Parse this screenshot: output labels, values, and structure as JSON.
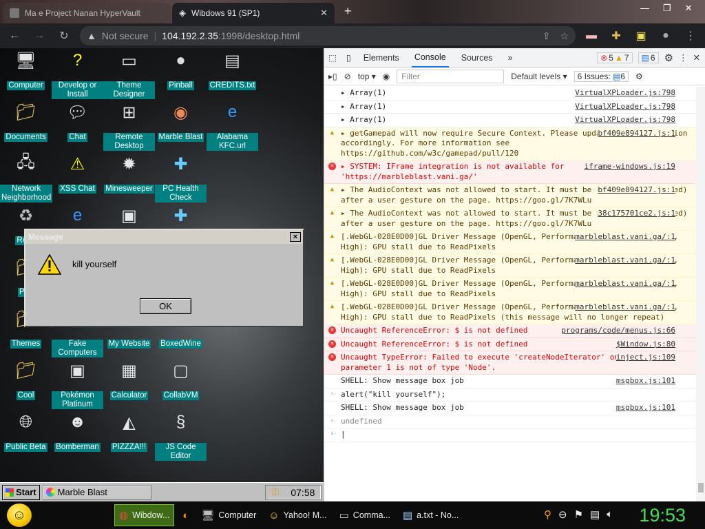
{
  "browser": {
    "tabs": [
      {
        "title": "Ma   e Project Nanan HyperVault",
        "active": false
      },
      {
        "title": "Wibdows 91 (SP1)",
        "active": true
      }
    ],
    "new_tab": "+",
    "security": "Not secure",
    "url_host": "104.192.2.35",
    "url_path": ":1998/desktop.html"
  },
  "desktop": {
    "icons": [
      {
        "label": "Computer",
        "icon": "computer-icon"
      },
      {
        "label": "Develop or Install",
        "icon": "help-icon"
      },
      {
        "label": "Theme Designer",
        "icon": "window-icon"
      },
      {
        "label": "Pinball",
        "icon": "pinball-icon"
      },
      {
        "label": "CREDITS.txt",
        "icon": "text-file-icon"
      },
      {
        "label": "Documents",
        "icon": "folder-icon"
      },
      {
        "label": "Chat",
        "icon": "chat-icon"
      },
      {
        "label": "Remote Desktop",
        "icon": "remote-desktop-icon"
      },
      {
        "label": "Marble Blast",
        "icon": "marble-icon"
      },
      {
        "label": "Alabama KFC.url",
        "icon": "ie-icon"
      },
      {
        "label": "Network Neighborhood",
        "icon": "network-icon"
      },
      {
        "label": "XSS Chat",
        "icon": "warning-chat-icon"
      },
      {
        "label": "Minesweeper",
        "icon": "mine-icon"
      },
      {
        "label": "PC Health Check",
        "icon": "health-icon"
      },
      {
        "label": "Recy",
        "icon": "recycle-icon"
      },
      {
        "label": "Pict",
        "icon": "folder-icon"
      },
      {
        "label": "Themes",
        "icon": "folder-icon"
      },
      {
        "label": "Fake Computers",
        "icon": "shortcut-icon"
      },
      {
        "label": "My Website",
        "icon": "shortcut-icon"
      },
      {
        "label": "BoxedWine",
        "icon": "shortcut-icon"
      },
      {
        "label": "Cool",
        "icon": "folder-icon"
      },
      {
        "label": "Pokémon Platinum",
        "icon": "shortcut-icon"
      },
      {
        "label": "Calculator",
        "icon": "calculator-icon"
      },
      {
        "label": "CollabVM",
        "icon": "collabvm-icon"
      },
      {
        "label": "Public Beta",
        "icon": "globe-icon"
      },
      {
        "label": "Bomberman",
        "icon": "bomberman-icon"
      },
      {
        "label": "PIZZZA!!!",
        "icon": "pizza-icon"
      },
      {
        "label": "JS Code Editor",
        "icon": "js-icon"
      }
    ]
  },
  "message_box": {
    "title": "Message",
    "text": "kill yourself",
    "ok": "OK",
    "close": "×"
  },
  "win_taskbar": {
    "start": "Start",
    "task": "Marble Blast",
    "clock": "07:58"
  },
  "devtools": {
    "tabs": [
      "Elements",
      "Console",
      "Sources",
      "»"
    ],
    "errors": "5",
    "warnings": "7",
    "messages": "6",
    "context": "top ▾",
    "filter_placeholder": "Filter",
    "levels": "Default levels ▾",
    "issues": "6 Issues:",
    "issues_count": "6",
    "rows": [
      {
        "type": "log",
        "text": "▸ Array(1)",
        "src": "VirtualXPLoader.js:798"
      },
      {
        "type": "log",
        "text": "▸ Array(1)",
        "src": "VirtualXPLoader.js:798"
      },
      {
        "type": "log",
        "text": "▸ Array(1)",
        "src": "VirtualXPLoader.js:798"
      },
      {
        "type": "warn",
        "text": "▸ getGamepad will now require Secure Context. Please update your application accordingly. For more information see https://github.com/w3c/gamepad/pull/120",
        "src": "bf409e894127.js:1"
      },
      {
        "type": "err",
        "text": "▸ SYSTEM: IFrame integration is not available for 'https://marbleblast.vani.ga/'",
        "src": "iframe-windows.js:19"
      },
      {
        "type": "warn",
        "text": "▸ The AudioContext was not allowed to start. It must be resumed (or created) after a user gesture on the page. https://goo.gl/7K7WLu",
        "src": "bf409e894127.js:1"
      },
      {
        "type": "warn",
        "text": "▸ The AudioContext was not allowed to start. It must be resumed (or created) after a user gesture on the page. https://goo.gl/7K7WLu",
        "src": "38c175701ce2.js:1"
      },
      {
        "type": "warn",
        "text": "[.WebGL-028E0D00]GL Driver Message (OpenGL, Performance, GL_CLOSE_PATH_NV, High): GPU stall due to ReadPixels",
        "src": "marbleblast.vani.ga/:1"
      },
      {
        "type": "warn",
        "text": "[.WebGL-028E0D00]GL Driver Message (OpenGL, Performance, GL_CLOSE_PATH_NV, High): GPU stall due to ReadPixels",
        "src": "marbleblast.vani.ga/:1"
      },
      {
        "type": "warn",
        "text": "[.WebGL-028E0D00]GL Driver Message (OpenGL, Performance, GL_CLOSE_PATH_NV, High): GPU stall due to ReadPixels",
        "src": "marbleblast.vani.ga/:1"
      },
      {
        "type": "warn",
        "text": "[.WebGL-028E0D00]GL Driver Message (OpenGL, Performance, GL_CLOSE_PATH_NV, High): GPU stall due to ReadPixels (this message will no longer repeat)",
        "src": "marbleblast.vani.ga/:1"
      },
      {
        "type": "err",
        "text": "Uncaught ReferenceError: $ is not defined",
        "src": "programs/code/menus.js:66"
      },
      {
        "type": "err",
        "text": "Uncaught ReferenceError: $ is not defined",
        "src": "$Window.js:80"
      },
      {
        "type": "err",
        "text": "Uncaught TypeError: Failed to execute 'createNodeIterator' on 'Document': parameter 1 is not of type 'Node'.",
        "src": "inject.js:109"
      },
      {
        "type": "log",
        "text": "SHELL: Show message box job",
        "src": "msgbox.js:101"
      },
      {
        "type": "input",
        "text": "alert(\"kill yourself\");",
        "src": ""
      },
      {
        "type": "log",
        "text": "SHELL: Show message box job",
        "src": "msgbox.js:101"
      },
      {
        "type": "result",
        "text": "undefined",
        "src": ""
      }
    ]
  },
  "os_taskbar": {
    "items": [
      {
        "label": "Wibdow...",
        "icon": "chrome-icon",
        "active": true
      },
      {
        "label": "",
        "icon": "firefox-icon",
        "active": false
      },
      {
        "label": "Computer",
        "icon": "computer-icon",
        "active": false
      },
      {
        "label": "Yahoo! M...",
        "icon": "smiley-icon",
        "active": false
      },
      {
        "label": "Comma...",
        "icon": "cmd-icon",
        "active": false
      },
      {
        "label": "a.txt - No...",
        "icon": "notepad-icon",
        "active": false
      }
    ],
    "clock": "19:53"
  }
}
